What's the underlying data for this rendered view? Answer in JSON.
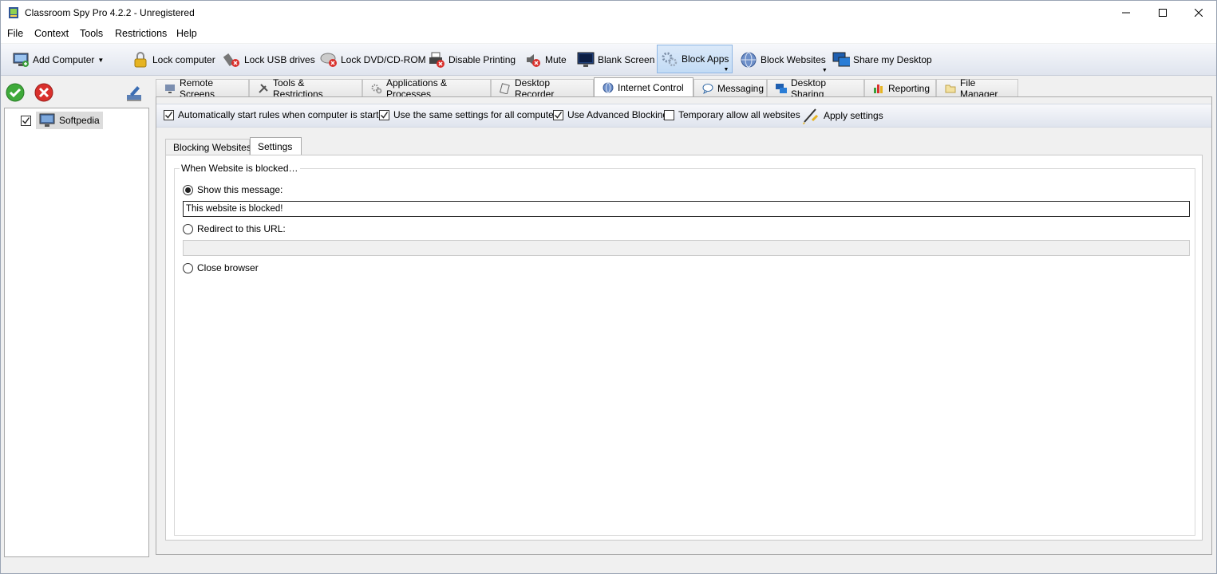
{
  "window": {
    "title": "Classroom Spy Pro 4.2.2 - Unregistered",
    "minimize": "—",
    "maximize": "☐",
    "close": "✕"
  },
  "menu": [
    "File",
    "Context",
    "Tools",
    "Restrictions",
    "Help"
  ],
  "toolbar": {
    "add_computer": "Add Computer",
    "lock_computer": "Lock computer",
    "lock_usb": "Lock USB drives",
    "lock_dvd": "Lock DVD/CD-ROM",
    "disable_printing": "Disable Printing",
    "mute": "Mute",
    "blank_screen": "Blank Screen",
    "block_apps": "Block Apps",
    "block_websites": "Block Websites",
    "share_desktop": "Share my Desktop"
  },
  "tree": {
    "computer": "Softpedia",
    "checked": true
  },
  "tabs": [
    {
      "label": "Remote Screens",
      "icon": "monitor-icon"
    },
    {
      "label": "Tools & Restrictions",
      "icon": "tools-icon"
    },
    {
      "label": "Applications & Processes",
      "icon": "gears-icon"
    },
    {
      "label": "Desktop Recorder",
      "icon": "recorder-icon"
    },
    {
      "label": "Internet Control",
      "icon": "globe-icon",
      "selected": true
    },
    {
      "label": "Messaging",
      "icon": "chat-icon"
    },
    {
      "label": "Desktop Sharing",
      "icon": "share-icon"
    },
    {
      "label": "Reporting",
      "icon": "bar-chart-icon"
    },
    {
      "label": "File Manager",
      "icon": "folder-icon"
    }
  ],
  "options": {
    "auto_start": "Automatically start rules when computer is started",
    "same_settings": "Use the same settings for all computers",
    "advanced_blocking": "Use Advanced Blocking",
    "temp_allow": "Temporary allow all websites",
    "apply": "Apply settings"
  },
  "subtabs": [
    "Blocking Websites",
    "Settings"
  ],
  "settings": {
    "group_title": "When Website is blocked…",
    "show_message_label": "Show this message:",
    "message_value": "This website is blocked!",
    "redirect_label": "Redirect to this URL:",
    "redirect_value": "",
    "close_browser_label": "Close browser"
  }
}
